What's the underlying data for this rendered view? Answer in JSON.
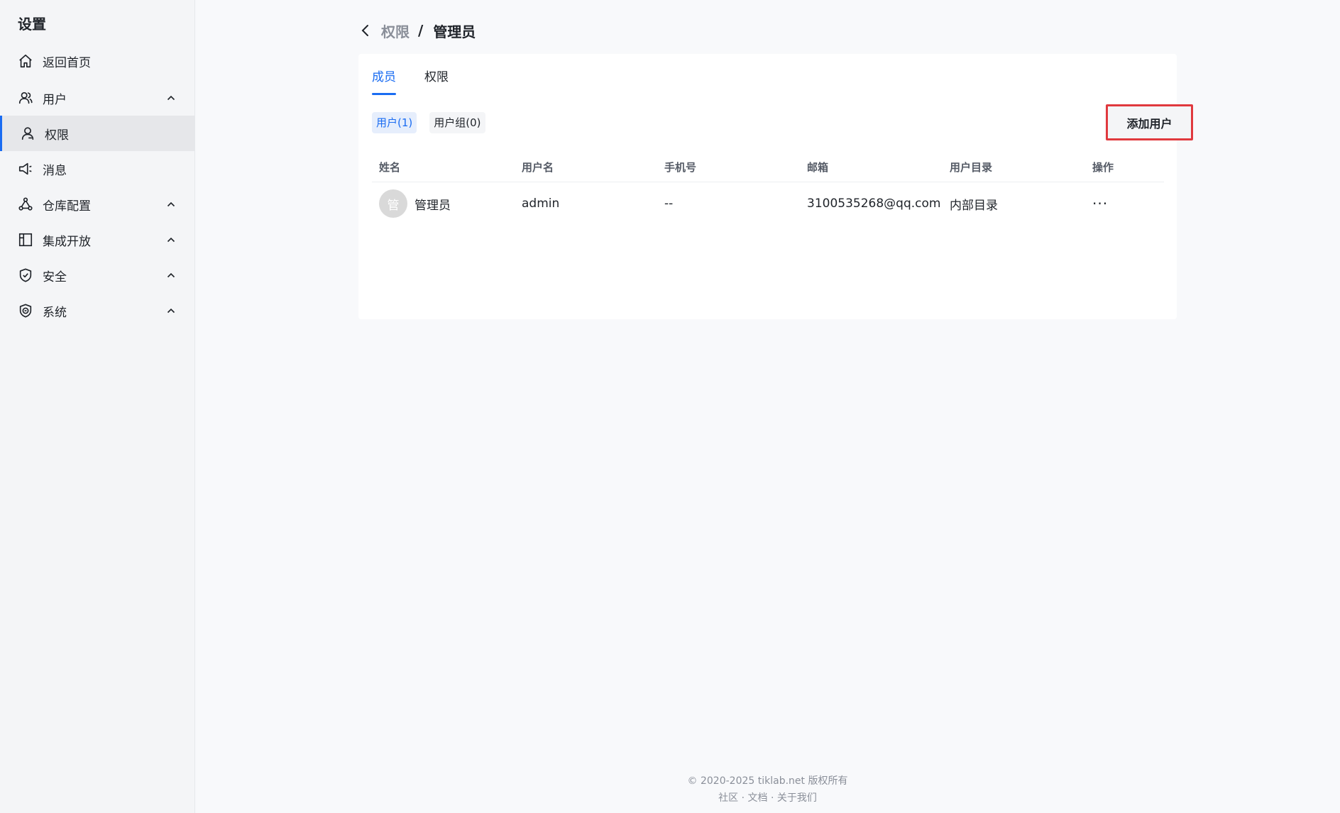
{
  "sidebar": {
    "title": "设置",
    "items": [
      {
        "label": "返回首页",
        "icon": "home-icon"
      },
      {
        "label": "用户",
        "icon": "users-icon"
      },
      {
        "label": "权限",
        "icon": "user-icon"
      },
      {
        "label": "消息",
        "icon": "megaphone-icon"
      },
      {
        "label": "仓库配置",
        "icon": "nodes-icon"
      },
      {
        "label": "集成开放",
        "icon": "layout-icon"
      },
      {
        "label": "安全",
        "icon": "shield-icon"
      },
      {
        "label": "系统",
        "icon": "system-badge-icon"
      }
    ]
  },
  "breadcrumb": {
    "parent": "权限",
    "separator": "/",
    "current": "管理员"
  },
  "tabs": [
    {
      "label": "成员"
    },
    {
      "label": "权限"
    }
  ],
  "subtabs": [
    {
      "label": "用户(1)"
    },
    {
      "label": "用户组(0)"
    }
  ],
  "add_button": {
    "label": "添加用户"
  },
  "table": {
    "columns": [
      "姓名",
      "用户名",
      "手机号",
      "邮箱",
      "用户目录",
      "操作"
    ],
    "rows": [
      {
        "avatar": "管",
        "name": "管理员",
        "username": "admin",
        "phone": "--",
        "email": "3100535268@qq.com",
        "directory": "内部目录",
        "action": "···"
      }
    ]
  },
  "footer": {
    "copyright": "© 2020-2025 tiklab.net 版权所有",
    "links": [
      "社区",
      "文档",
      "关于我们"
    ],
    "link_separator": "·"
  },
  "colors": {
    "accent": "#1a6cf2",
    "highlight_border": "#e0393e"
  }
}
